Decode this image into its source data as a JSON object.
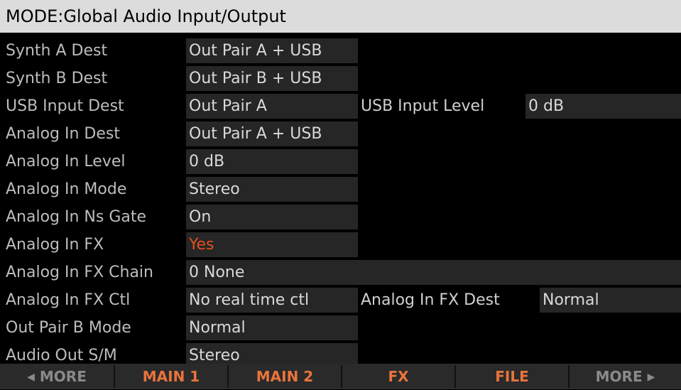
{
  "header": {
    "title": "MODE:Global Audio Input/Output"
  },
  "params": [
    {
      "label": "Synth A Dest",
      "value": "Out Pair A + USB"
    },
    {
      "label": "Synth B Dest",
      "value": "Out Pair B + USB"
    },
    {
      "label": "USB Input Dest",
      "value": "Out Pair A",
      "label2": "USB Input Level",
      "value2": "0 dB"
    },
    {
      "label": "Analog In Dest",
      "value": "Out Pair A + USB"
    },
    {
      "label": "Analog In Level",
      "value": "0 dB"
    },
    {
      "label": "Analog In Mode",
      "value": "Stereo"
    },
    {
      "label": "Analog In Ns Gate",
      "value": "On"
    },
    {
      "label": "Analog In FX",
      "value": "Yes"
    },
    {
      "label": "Analog In FX Chain",
      "value": "0 None"
    },
    {
      "label": "Analog In FX Ctl",
      "value": "No real time ctl",
      "label2": "Analog In FX Dest",
      "value2": "Normal"
    },
    {
      "label": "Out Pair B Mode",
      "value": "Normal"
    },
    {
      "label": "Audio Out S/M",
      "value": "Stereo"
    }
  ],
  "softbuttons": [
    {
      "label": "MORE",
      "icon": "left-arrow-icon"
    },
    {
      "label": "MAIN 1"
    },
    {
      "label": "MAIN 2"
    },
    {
      "label": "FX"
    },
    {
      "label": "FILE"
    },
    {
      "label": "MORE",
      "icon": "right-arrow-icon"
    }
  ],
  "colors": {
    "background": "#000000",
    "header_bg": "#dcdcdc",
    "field_bg": "#262626",
    "highlight": "#e0501e",
    "softbutton_text": "#e8743b",
    "softbutton_dim": "#8a8a8a"
  }
}
